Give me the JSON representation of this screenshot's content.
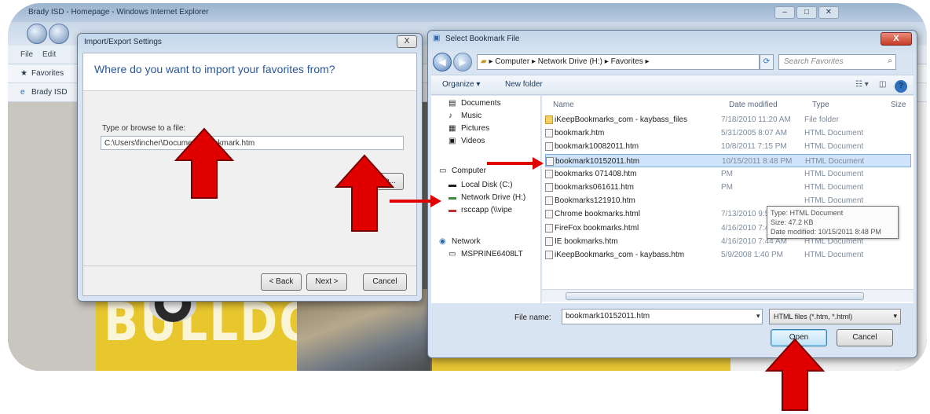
{
  "ie": {
    "title": "Brady ISD - Homepage - Windows Internet Explorer",
    "menu": [
      "File",
      "Edit"
    ],
    "favorites_label": "Favorites",
    "tab_label": "Brady ISD"
  },
  "page_banner": "BULLDOGS!",
  "import_dialog": {
    "title": "Import/Export Settings",
    "close": "X",
    "heading": "Where do you want to import your favorites from?",
    "field_label": "Type or browse to a file:",
    "field_value": "C:\\Users\\fincher\\Documents\\bookmark.htm",
    "browse": "Browse...",
    "back": "< Back",
    "next": "Next >",
    "cancel": "Cancel"
  },
  "bookmark_dialog": {
    "title": "Select Bookmark File",
    "close": "X",
    "address_path": "▸ Computer ▸ Network Drive (H:) ▸ Favorites ▸",
    "search_placeholder": "Search Favorites",
    "toolbar": {
      "organize": "Organize ▾",
      "new_folder": "New folder"
    },
    "nav": [
      {
        "label": "Documents",
        "icon": "documents-icon"
      },
      {
        "label": "Music",
        "icon": "music-icon"
      },
      {
        "label": "Pictures",
        "icon": "pictures-icon"
      },
      {
        "label": "Videos",
        "icon": "videos-icon"
      },
      {
        "label": "Computer",
        "icon": "computer-icon"
      },
      {
        "label": "Local Disk (C:)",
        "icon": "disk-icon"
      },
      {
        "label": "Network Drive (H:)",
        "icon": "network-drive-icon"
      },
      {
        "label": "rsccapp (\\\\vipe",
        "icon": "network-drive-icon"
      },
      {
        "label": "Network",
        "icon": "network-icon"
      },
      {
        "label": "MSPRINE6408LT",
        "icon": "pc-icon"
      }
    ],
    "columns": [
      "Name",
      "Date modified",
      "Type",
      "Size"
    ],
    "files": [
      {
        "name": "iKeepBookmarks_com - kaybass_files",
        "date": "7/18/2010 11:20 AM",
        "type": "File folder",
        "folder": true
      },
      {
        "name": "bookmark.htm",
        "date": "5/31/2005 8:07 AM",
        "type": "HTML Document"
      },
      {
        "name": "bookmark10082011.htm",
        "date": "10/8/2011 7:15 PM",
        "type": "HTML Document"
      },
      {
        "name": "bookmark10152011.htm",
        "date": "10/15/2011 8:48 PM",
        "type": "HTML Document",
        "selected": true
      },
      {
        "name": "bookmarks 071408.htm",
        "date": "PM",
        "type": "HTML Document"
      },
      {
        "name": "bookmarks061611.htm",
        "date": "PM",
        "type": "HTML Document"
      },
      {
        "name": "Bookmarks121910.htm",
        "date": "",
        "type": "HTML Document"
      },
      {
        "name": "Chrome bookmarks.html",
        "date": "7/13/2010 9:57 AM",
        "type": "HTML Document"
      },
      {
        "name": "FireFox bookmarks.html",
        "date": "4/16/2010 7:44 AM",
        "type": "HTML Document"
      },
      {
        "name": "IE bookmarks.htm",
        "date": "4/16/2010 7:44 AM",
        "type": "HTML Document"
      },
      {
        "name": "iKeepBookmarks_com - kaybass.htm",
        "date": "5/9/2008 1:40 PM",
        "type": "HTML Document"
      }
    ],
    "tooltip": {
      "type": "Type: HTML Document",
      "size": "Size: 47.2 KB",
      "date": "Date modified: 10/15/2011 8:48 PM"
    },
    "file_name_label": "File name:",
    "file_name_value": "bookmark10152011.htm",
    "file_type": "HTML files (*.htm, *.html)",
    "open": "Open",
    "cancel": "Cancel"
  },
  "annotation_color": "#e00000"
}
